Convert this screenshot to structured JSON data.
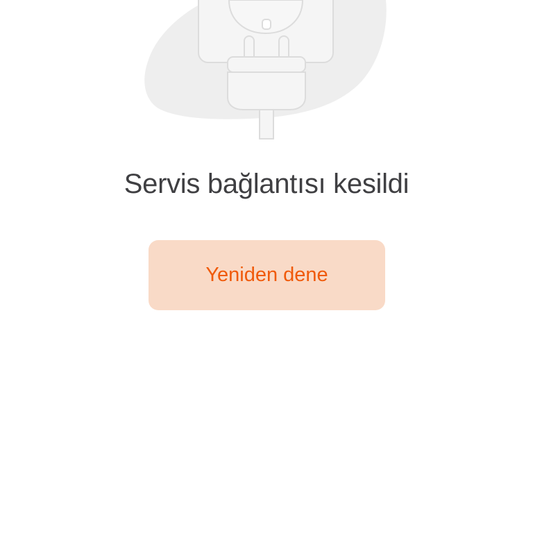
{
  "illustration": {
    "icon": "unplugged-power-plug-icon",
    "blob_color": "#eeeeee",
    "outline_color": "#dcdcdc"
  },
  "error": {
    "message": "Servis bağlantısı kesildi"
  },
  "retry_button": {
    "label": "Yeniden dene",
    "background_color": "#f9dac7",
    "text_color": "#f05a0a"
  }
}
